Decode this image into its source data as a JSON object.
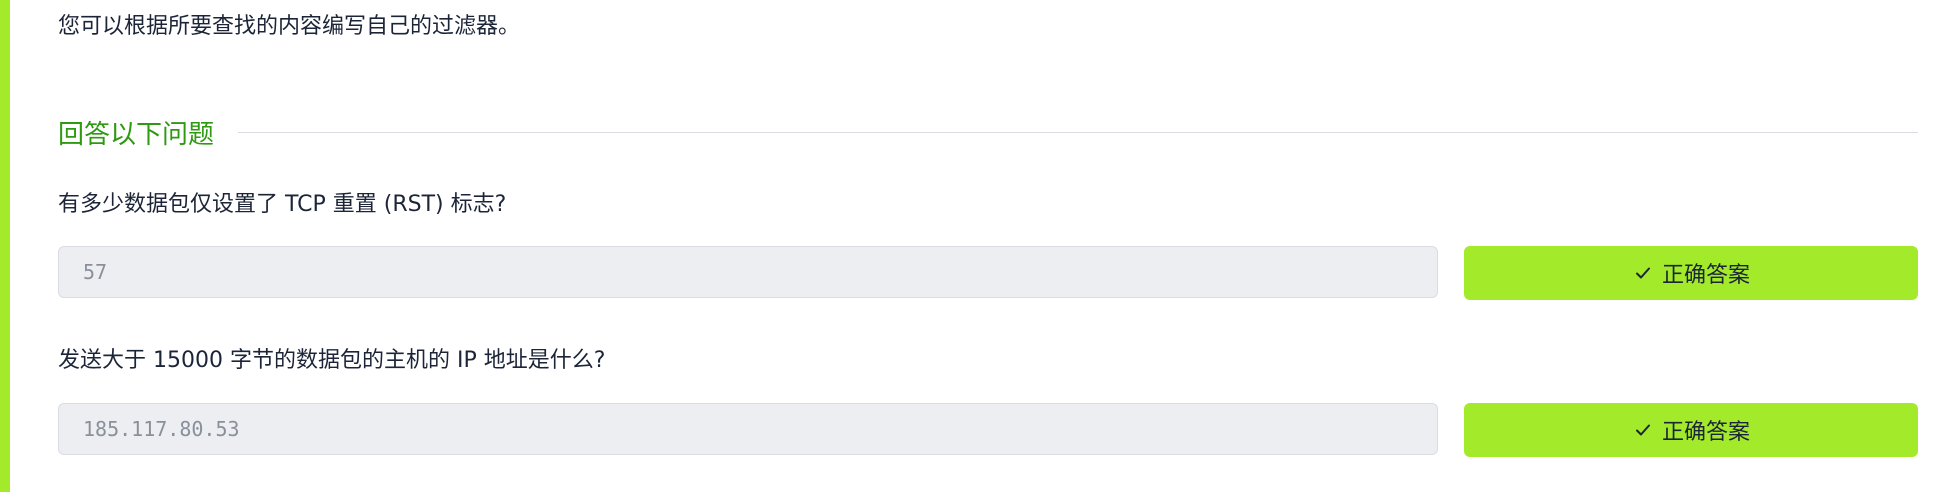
{
  "intro_text": "您可以根据所要查找的内容编写自己的过滤器。",
  "section": {
    "title": "回答以下问题"
  },
  "questions": [
    {
      "text": "有多少数据包仅设置了 TCP 重置 (RST) 标志?",
      "answer": "57",
      "button_label": "正确答案"
    },
    {
      "text": "发送大于 15000 字节的数据包的主机的 IP 地址是什么?",
      "answer": "185.117.80.53",
      "button_label": "正确答案"
    }
  ],
  "icons": {
    "button_icon": "check-icon"
  },
  "colors": {
    "accent": "#a3ea2a",
    "section_title": "#2e9a12",
    "text": "#1c2538",
    "field_bg": "#eceef1",
    "field_text": "#8a909b"
  }
}
